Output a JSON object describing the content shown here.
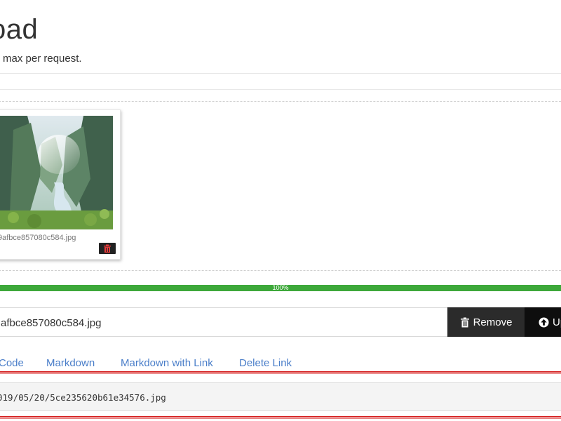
{
  "header": {
    "title": "oad",
    "subtitle": "max per request."
  },
  "preview": {
    "file_name": "9afbce857080c584.jpg"
  },
  "progress": {
    "percent": 100,
    "label": "100%",
    "color": "#3da83a"
  },
  "file_input": {
    "value": "afbce857080c584.jpg"
  },
  "buttons": {
    "remove_label": "Remove",
    "upload_label": "Up"
  },
  "tabs": [
    {
      "label": "Code"
    },
    {
      "label": "Markdown"
    },
    {
      "label": "Markdown with Link"
    },
    {
      "label": "Delete Link"
    }
  ],
  "result": {
    "code": "019/05/20/5ce235620b61e34576.jpg"
  },
  "colors": {
    "accent_link": "#4a7ec9",
    "highlight_red": "#d62525",
    "button_dark": "#2b2b2b"
  },
  "icons": {
    "delete": "trash-icon",
    "remove": "trash-icon",
    "upload": "upload-circle-icon"
  }
}
